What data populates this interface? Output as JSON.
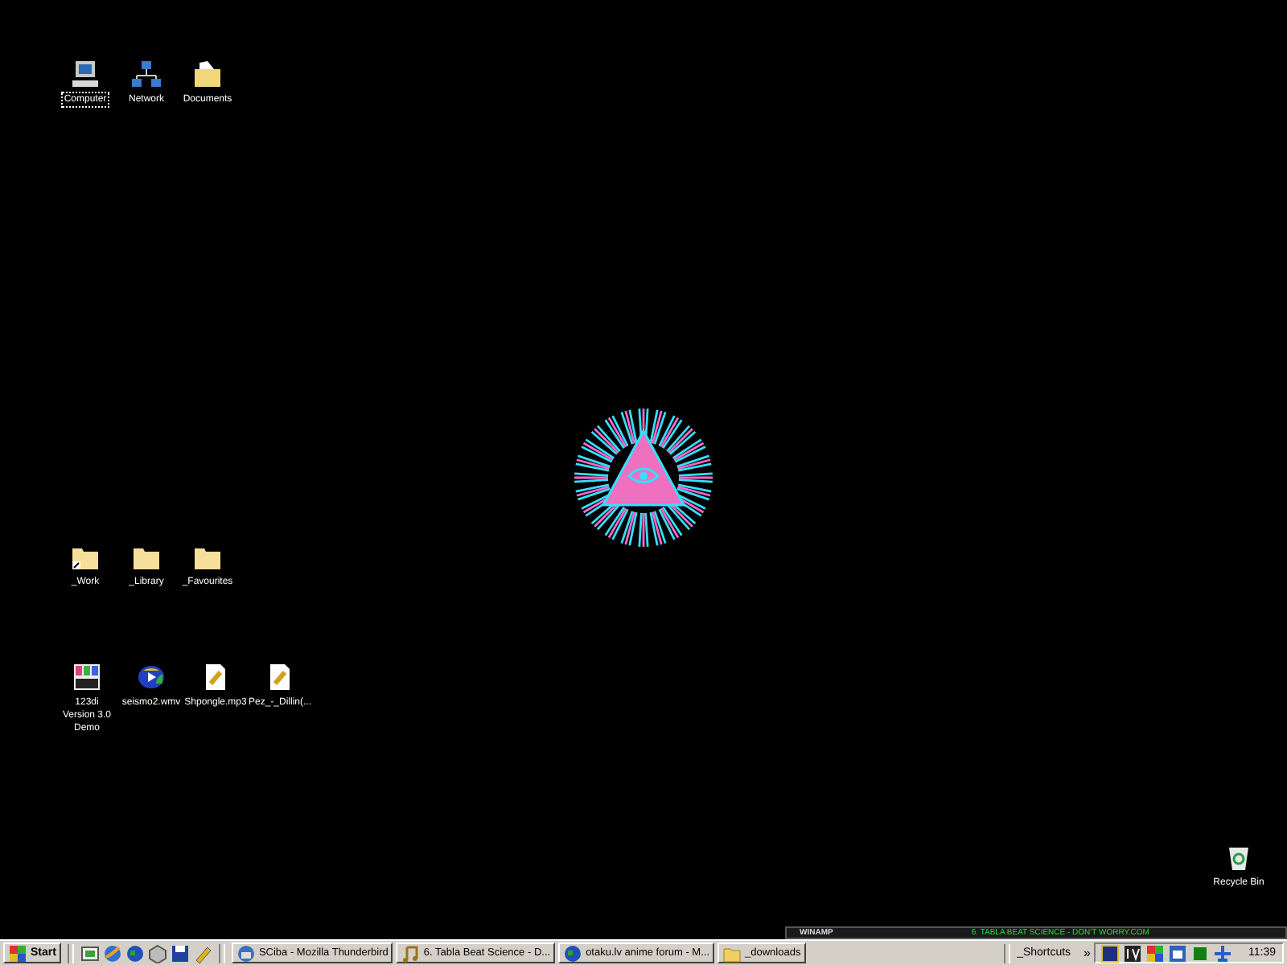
{
  "desktop": {
    "icon_groups": [
      {
        "icons": [
          {
            "label": "Computer",
            "kind": "computer",
            "selected": true
          },
          {
            "label": "Network",
            "kind": "network",
            "selected": false
          },
          {
            "label": "Documents",
            "kind": "documents",
            "selected": false
          }
        ]
      },
      {
        "icons": [
          {
            "label": "_Work",
            "kind": "folder-shortcut",
            "selected": false
          },
          {
            "label": "_Library",
            "kind": "folder",
            "selected": false
          },
          {
            "label": "_Favourites",
            "kind": "folder",
            "selected": false
          }
        ]
      },
      {
        "icons": [
          {
            "label": "123di Version 3.0 Demo",
            "kind": "app",
            "selected": false
          },
          {
            "label": "seismo2.wmv",
            "kind": "media",
            "selected": false
          },
          {
            "label": "Shpongle.mp3",
            "kind": "audio",
            "selected": false
          },
          {
            "label": "Pez_-_Dillin(...",
            "kind": "audio",
            "selected": false
          }
        ]
      }
    ],
    "recycle_bin": {
      "label": "Recycle Bin"
    },
    "winamp": {
      "title": "WINAMP",
      "song": "6. TABLA BEAT SCIENCE - DON'T WORRY.COM"
    }
  },
  "taskbar": {
    "start": "Start",
    "quick_launch": [
      {
        "kind": "desktop"
      },
      {
        "kind": "browser"
      },
      {
        "kind": "globe"
      },
      {
        "kind": "cube"
      },
      {
        "kind": "disk"
      },
      {
        "kind": "pen"
      }
    ],
    "tasks": [
      {
        "label": "SCiba - Mozilla Thunderbird",
        "kind": "mail",
        "selected": false
      },
      {
        "label": "6. Tabla Beat Science - D...",
        "kind": "music",
        "selected": false
      },
      {
        "label": "otaku.lv anime forum - M...",
        "kind": "globe",
        "selected": false
      },
      {
        "label": "_downloads",
        "kind": "folder",
        "selected": false
      }
    ],
    "toolbar": {
      "label": "_Shortcuts",
      "chevron": "»"
    },
    "tray": [
      {
        "kind": "square"
      },
      {
        "kind": "letter"
      },
      {
        "kind": "colors"
      },
      {
        "kind": "window"
      },
      {
        "kind": "green"
      },
      {
        "kind": "plane"
      }
    ],
    "clock": "11:39"
  }
}
